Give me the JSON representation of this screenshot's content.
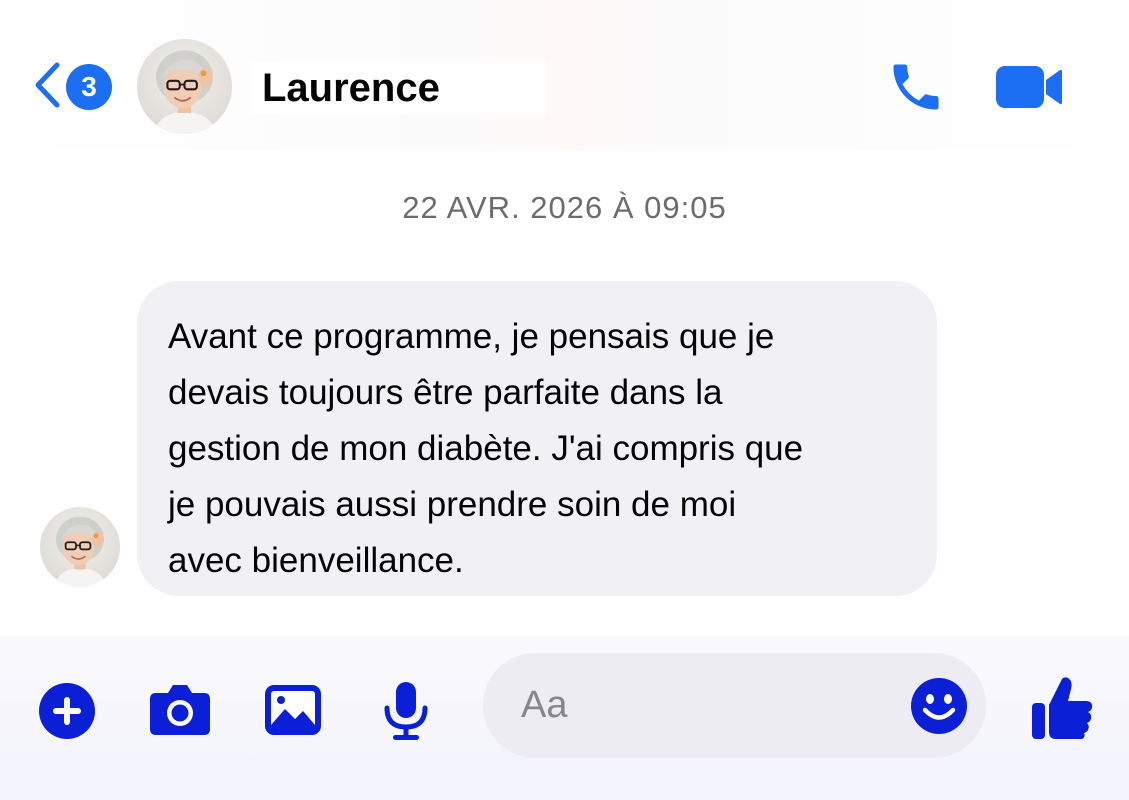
{
  "header": {
    "back_badge_count": "3",
    "contact_name": "Laurence"
  },
  "conversation": {
    "timestamp": "22 AVR. 2026 À 09:05",
    "messages": [
      {
        "sender": "Laurence",
        "text": "Avant ce programme, je pensais que je\ndevais toujours être parfaite dans la\ngestion de mon diabète. J'ai compris que\nje pouvais aussi prendre soin de moi\navec bienveillance."
      }
    ]
  },
  "composer": {
    "placeholder": "Aa",
    "value": ""
  },
  "icons": {
    "back": "chevron-left-icon",
    "call": "phone-icon",
    "video": "video-camera-icon",
    "plus": "plus-circle-icon",
    "camera": "camera-icon",
    "gallery": "image-icon",
    "mic": "microphone-icon",
    "emoji": "smiley-icon",
    "like": "thumbs-up-icon"
  },
  "colors": {
    "accent_blue": "#1c6ef2",
    "composer_blue": "#0a1fd6",
    "bubble_bg": "#f0f0f5",
    "timestamp_gray": "#6b6b70"
  }
}
